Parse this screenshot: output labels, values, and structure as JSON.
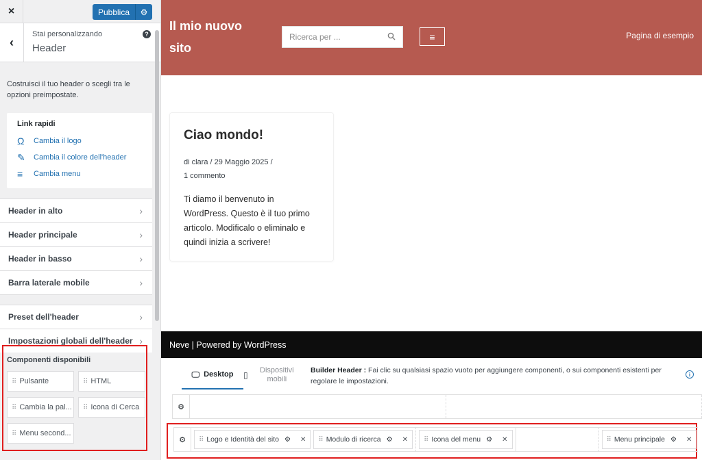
{
  "sidebar": {
    "close_icon": "×",
    "publish_label": "Pubblica",
    "subtitle": "Stai personalizzando",
    "title": "Header",
    "help": "?",
    "description": "Costruisci il tuo header o scegli tra le opzioni preimpostate.",
    "quick_links": {
      "title": "Link rapidi",
      "items": [
        {
          "label": "Cambia il logo",
          "icon": "omega-icon"
        },
        {
          "label": "Cambia il colore dell'header",
          "icon": "brush-icon"
        },
        {
          "label": "Cambia menu",
          "icon": "menu-icon"
        }
      ]
    },
    "sections": [
      "Header in alto",
      "Header principale",
      "Header in basso",
      "Barra laterale mobile"
    ],
    "sections2": [
      "Preset dell'header",
      "Impostazioni globali dell'header"
    ],
    "components": {
      "title": "Componenti disponibili",
      "items": [
        "Pulsante",
        "HTML",
        "Cambia la pal...",
        "Icona di Cerca",
        "Menu second..."
      ]
    }
  },
  "preview": {
    "site_title": "Il mio nuovo sito",
    "search_placeholder": "Ricerca per ...",
    "nav_link": "Pagina di esempio",
    "post": {
      "title": "Ciao mondo!",
      "meta_line1": "di clara  /  29 Maggio 2025  /",
      "meta_line2": "1 commento",
      "body": "Ti diamo il benvenuto in WordPress. Questo è il tuo primo articolo. Modificalo o eliminalo e quindi inizia a scrivere!"
    },
    "footer": "Neve | Powered by WordPress"
  },
  "builder": {
    "tab_desktop": "Desktop",
    "tab_mobile": "Dispositivi mobili",
    "info_title": "Builder Header :",
    "info_text": "Fai clic su qualsiasi spazio vuoto per aggiungere componenti, o sui componenti esistenti per regolare le impostazioni.",
    "chips": [
      "Logo e Identità del sito",
      "Modulo di ricerca",
      "Icona del menu",
      "Menu principale"
    ]
  },
  "colors": {
    "header_bg": "#b65a50",
    "accent": "#2271b1",
    "highlight": "#e01e1e"
  }
}
